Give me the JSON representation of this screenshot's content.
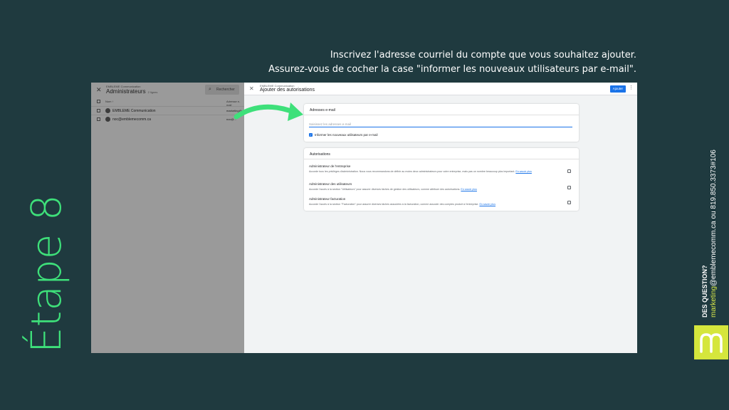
{
  "instructions": {
    "line1": "Inscrivez l'adresse courriel du compte que vous souhaitez ajouter.",
    "line2": "Assurez-vous de cocher la case \"informer les nouveaux utilisateurs par e-mail\"."
  },
  "step_title": "Étape 8",
  "contact": {
    "heading": "DES QUESTION?",
    "email_user": "marketing",
    "email_rest": "@emblemecomm.ca ou 819.850.3373#106"
  },
  "logo_letter": "m",
  "colors": {
    "background": "#1f3a3f",
    "accent_green": "#3ee07a",
    "logo_yellow": "#d5e63c",
    "primary_blue": "#1a73e8"
  },
  "left_panel": {
    "company": "EMBLEME Communication",
    "title": "Administrateurs",
    "count": "2 lignes",
    "search_placeholder": "Rechercher",
    "col_name": "Nom ↑",
    "col_email": "Adresse e-mail",
    "rows": [
      {
        "name": "EMBLEME Communication",
        "email": "marketing@..."
      },
      {
        "name": "noc@emblemecomm.ca",
        "email": "noc@..."
      }
    ]
  },
  "right_panel": {
    "company": "EMBLEME Communication",
    "title": "Ajouter des autorisations",
    "add_button": "Ajouter",
    "email_section": {
      "heading": "Adresses e-mail",
      "placeholder": "Saisissez les adresses e-mail",
      "notify_label": "Informer les nouveaux utilisateurs par e-mail",
      "notify_checked": true
    },
    "permissions": {
      "heading": "Autorisations",
      "items": [
        {
          "title": "Administrateur de l'entreprise",
          "desc": "Accorde tous les privilèges d'administration. Nous vous recommandons de définir au moins deux administrateurs pour votre entreprise, mais pas un nombre beaucoup plus important.",
          "link": "En savoir plus"
        },
        {
          "title": "Administrateur des utilisateurs",
          "desc": "Accorde l'accès à la section \"Utilisateurs\" pour assurer diverses tâches de gestion des utilisateurs, comme attribuer des autorisations.",
          "link": "En savoir plus"
        },
        {
          "title": "Administrateur facturation",
          "desc": "Accorde l'accès à la section \"Facturation\" pour assurer diverses tâches associées à la facturation, comme associer des comptes produit à l'entreprise.",
          "link": "En savoir plus"
        }
      ]
    }
  }
}
